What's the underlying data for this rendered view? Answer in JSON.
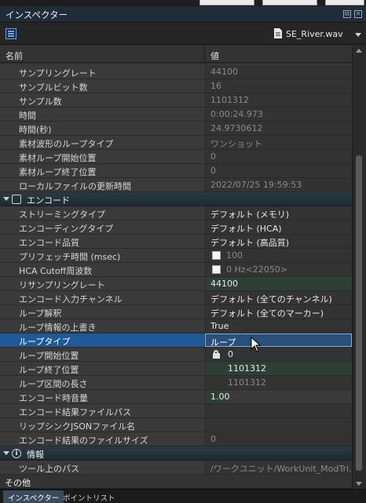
{
  "window": {
    "title": "インスペクター",
    "file_name": "SE_River.wav"
  },
  "columns": {
    "name": "名前",
    "value": "値"
  },
  "rows_top": [
    {
      "name": "サンプリングレート",
      "value": "44100"
    },
    {
      "name": "サンプルビット数",
      "value": "16"
    },
    {
      "name": "サンプル数",
      "value": "1101312"
    },
    {
      "name": "時間",
      "value": "0:00:24.973"
    },
    {
      "name": "時間(秒)",
      "value": "24.9730612"
    },
    {
      "name": "素材波形のループタイプ",
      "value": "ワンショット"
    },
    {
      "name": "素材ループ開始位置",
      "value": "0"
    },
    {
      "name": "素材ループ終了位置",
      "value": "0"
    },
    {
      "name": "ローカルファイルの更新時間",
      "value": "2022/07/25 19:59:53"
    }
  ],
  "group_encode": {
    "label": "エンコード",
    "rows": [
      {
        "name": "ストリーミングタイプ",
        "value": "デフォルト (メモリ)"
      },
      {
        "name": "エンコーディングタイプ",
        "value": "デフォルト (HCA)"
      },
      {
        "name": "エンコード品質",
        "value": "デフォルト (高品質)"
      },
      {
        "name": "プリフェッチ時間 (msec)",
        "value": "100"
      },
      {
        "name": "HCA Cutoff周波数",
        "value": "0 Hz<22050>"
      },
      {
        "name": "リサンプリングレート",
        "value": "44100"
      },
      {
        "name": "エンコード入力チャンネル",
        "value": "デフォルト (全てのチャンネル)"
      },
      {
        "name": "ループ解釈",
        "value": "デフォルト (全てのマーカー)"
      },
      {
        "name": "ループ情報の上書き",
        "value": "True"
      },
      {
        "name": "ループタイプ",
        "value": "ループ"
      },
      {
        "name": "ループ開始位置",
        "value": "0"
      },
      {
        "name": "ループ終了位置",
        "value": "1101312"
      },
      {
        "name": "ループ区間の長さ",
        "value": "1101312"
      },
      {
        "name": "エンコード時音量",
        "value": "1.00"
      },
      {
        "name": "エンコード結果ファイルパス",
        "value": ""
      },
      {
        "name": "リップシンクJSONファイル名",
        "value": ""
      },
      {
        "name": "エンコード結果のファイルサイズ",
        "value": "0"
      }
    ]
  },
  "group_info": {
    "label": "情報",
    "rows": [
      {
        "name": "ツール上のパス",
        "value": "/ワークユニット/WorkUnit_ModTri..."
      }
    ]
  },
  "group_other": {
    "label": "その他"
  },
  "bottom_tabs": [
    "インスペクター",
    "ポイントリスト"
  ],
  "colors": {
    "title_bar": "#1f2d3a",
    "group_header": "#2a3a44",
    "selection": "#1f5a96",
    "accent": "#5aa7ff"
  }
}
